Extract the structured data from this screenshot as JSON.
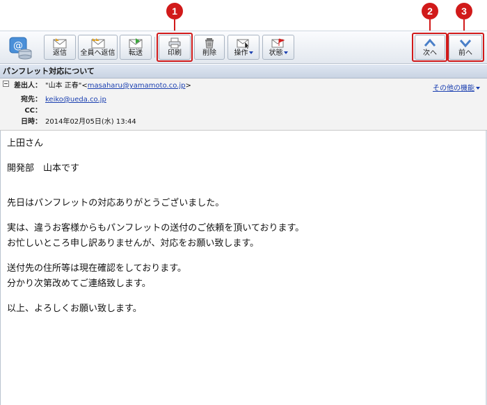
{
  "callouts": [
    "1",
    "2",
    "3"
  ],
  "toolbar": {
    "buttons": [
      {
        "id": "reply",
        "label": "返信"
      },
      {
        "id": "reply-all",
        "label": "全員へ返信"
      },
      {
        "id": "forward",
        "label": "転送"
      },
      {
        "id": "print",
        "label": "印刷"
      },
      {
        "id": "delete",
        "label": "削除"
      },
      {
        "id": "operation",
        "label": "操作"
      },
      {
        "id": "status",
        "label": "状態"
      },
      {
        "id": "next",
        "label": "次へ"
      },
      {
        "id": "prev",
        "label": "前へ"
      }
    ]
  },
  "subject": "パンフレット対応について",
  "header": {
    "from_label": "差出人：",
    "from_name": "\"山本 正春\"<",
    "from_email": "masaharu@yamamoto.co.jp",
    "from_close": ">",
    "to_label": "宛先：",
    "to_email": "keiko@ueda.co.jp",
    "cc_label": "CC：",
    "date_label": "日時：",
    "date_value": "2014年02月05日(水) 13:44",
    "more_features": "その他の機能"
  },
  "body": {
    "lines": [
      "上田さん",
      "開発部　山本です",
      "先日はパンフレットの対応ありがとうございました。",
      "実は、違うお客様からもパンフレットの送付のご依頼を頂いております。",
      "お忙しいところ申し訳ありませんが、対応をお願い致します。",
      "送付先の住所等は現在確認をしております。",
      "分かり次第改めてご連絡致します。",
      "以上、よろしくお願い致します。"
    ]
  },
  "colors": {
    "accent": "#d11a1a",
    "link": "#1a3fb0",
    "nav_arrow": "#4a7fc8"
  }
}
